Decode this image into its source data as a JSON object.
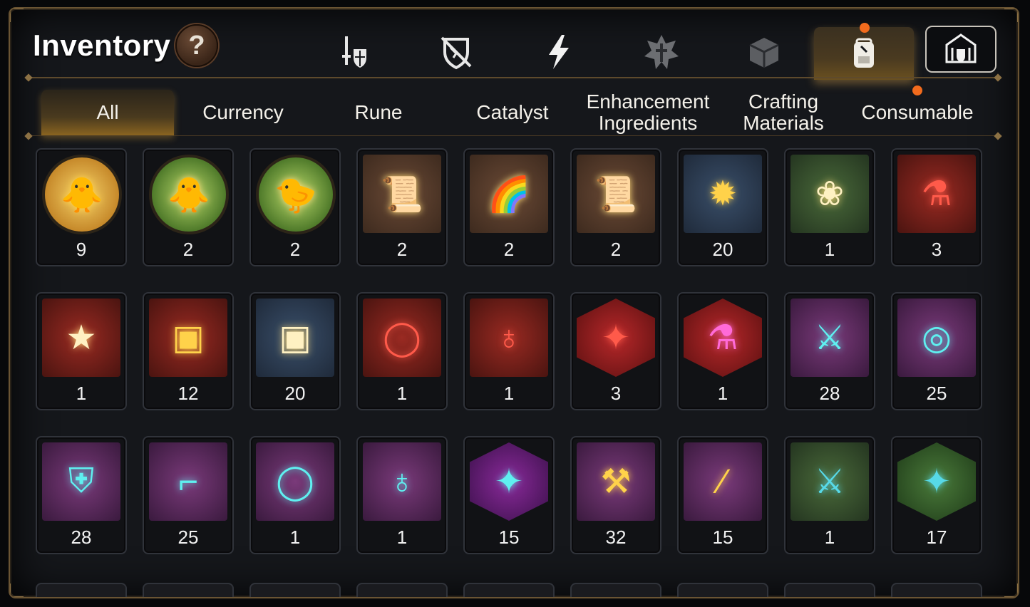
{
  "title": "Inventory",
  "help_icon": "?",
  "category_icons": [
    {
      "name": "sword-shield-icon",
      "active": false
    },
    {
      "name": "broken-shield-icon",
      "active": false
    },
    {
      "name": "lightning-icon",
      "active": false
    },
    {
      "name": "cross-emblem-icon",
      "active": false
    },
    {
      "name": "cube-icon",
      "active": false
    },
    {
      "name": "backpack-icon",
      "active": true,
      "notification": true
    },
    {
      "name": "armory-icon",
      "active": false,
      "boxed": true
    }
  ],
  "tabs": [
    {
      "label": "All",
      "active": true
    },
    {
      "label": "Currency"
    },
    {
      "label": "Rune"
    },
    {
      "label": "Catalyst"
    },
    {
      "label": "Enhancement Ingredients"
    },
    {
      "label": "Crafting Materials"
    },
    {
      "label": "Consumable",
      "notification": true
    }
  ],
  "colors": {
    "accent": "#d8a34a",
    "notification": "#f26b1d",
    "frame": "#6a5433"
  },
  "items": [
    [
      {
        "icon": "golden-chick-icon",
        "bg": "circle-gold",
        "qty": "9"
      },
      {
        "icon": "yellow-chick-icon",
        "bg": "circle-green",
        "qty": "2"
      },
      {
        "icon": "green-chick-icon",
        "bg": "circle-green",
        "qty": "2"
      },
      {
        "icon": "scroll-upgrade-icon",
        "bg": "brown",
        "qty": "2"
      },
      {
        "icon": "rainbow-scroll-icon",
        "bg": "brown",
        "qty": "2"
      },
      {
        "icon": "scroll-upgrade-icon",
        "bg": "brown",
        "qty": "2"
      },
      {
        "icon": "gold-crystal-icon",
        "bg": "blue",
        "qty": "20"
      },
      {
        "icon": "silver-flower-icon",
        "bg": "green",
        "qty": "1"
      },
      {
        "icon": "red-potion-icon",
        "bg": "red",
        "qty": "3"
      }
    ],
    [
      {
        "icon": "star-wand-icon",
        "bg": "red",
        "qty": "1"
      },
      {
        "icon": "gold-chest-icon",
        "bg": "red",
        "qty": "12"
      },
      {
        "icon": "silver-chest-icon",
        "bg": "blue",
        "qty": "20"
      },
      {
        "icon": "red-ring-rune-icon",
        "bg": "red",
        "qty": "1"
      },
      {
        "icon": "red-necklace-rune-icon",
        "bg": "red",
        "qty": "1"
      },
      {
        "icon": "red-star-rune-icon",
        "bg": "hex-red",
        "qty": "3"
      },
      {
        "icon": "pink-potion-icon",
        "bg": "hex-red",
        "qty": "1"
      },
      {
        "icon": "teal-sword-rune-icon",
        "bg": "purple",
        "qty": "28"
      },
      {
        "icon": "teal-spiral-rune-icon",
        "bg": "purple",
        "qty": "25"
      }
    ],
    [
      {
        "icon": "teal-armor-rune-icon",
        "bg": "purple",
        "qty": "28"
      },
      {
        "icon": "teal-boot-rune-icon",
        "bg": "purple",
        "qty": "25"
      },
      {
        "icon": "teal-ring-rune-icon",
        "bg": "purple",
        "qty": "1"
      },
      {
        "icon": "teal-necklace-rune-icon",
        "bg": "purple",
        "qty": "1"
      },
      {
        "icon": "teal-star-rune-icon",
        "bg": "hex-purple",
        "qty": "15"
      },
      {
        "icon": "gold-hammer-rune-icon",
        "bg": "purple",
        "qty": "32"
      },
      {
        "icon": "gold-blade-rune-icon",
        "bg": "purple",
        "qty": "15"
      },
      {
        "icon": "stone-sword-rune-icon",
        "bg": "green",
        "qty": "1"
      },
      {
        "icon": "stone-star-rune-icon",
        "bg": "hex-green",
        "qty": "17"
      }
    ]
  ]
}
